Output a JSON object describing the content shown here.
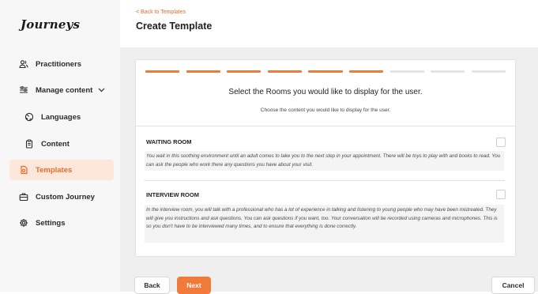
{
  "app": {
    "logo": "Journeys"
  },
  "colors": {
    "accent": "#f07a3a",
    "step_active": "#f07a3a",
    "step_inactive": "#e4e4e4",
    "active_bg": "#fde7da"
  },
  "sidebar": {
    "items": [
      {
        "label": "Practitioners",
        "icon": "users-icon",
        "active": false
      },
      {
        "label": "Manage content",
        "icon": "sliders-icon",
        "active": false,
        "expanded": true
      },
      {
        "label": "Languages",
        "icon": "globe-icon",
        "active": false,
        "sub": true
      },
      {
        "label": "Content",
        "icon": "clipboard-icon",
        "active": false,
        "sub": true
      },
      {
        "label": "Templates",
        "icon": "template-icon",
        "active": true
      },
      {
        "label": "Custom Journey",
        "icon": "briefcase-icon",
        "active": false
      },
      {
        "label": "Settings",
        "icon": "gear-icon",
        "active": false
      }
    ]
  },
  "header": {
    "back_link": "< Back to Templates",
    "title": "Create Template"
  },
  "wizard": {
    "steps_total": 9,
    "steps_completed": 6,
    "title": "Select the Rooms you would like to display for the user.",
    "subtitle": "Choose the content you would like to display for the user.",
    "rooms": [
      {
        "name": "WAITING ROOM",
        "description": "You wait in this soothing environment until an adult comes to take you to the next step in your appointment. There will be toys to play with and books to read. You can ask the people who work there any questions you have about your visit.",
        "checked": false
      },
      {
        "name": "INTERVIEW ROOM",
        "description": "In the interview room, you will talk with a professional who has a lot of experience in talking and listening to young people who may have been mistreated. They will give you instructions and ask questions. You can ask questions if you want, too. Your conversation will be recorded using cameras and microphones. This is so you don't have to be interviewed many times, and to ensure that everything is done correctly.",
        "checked": false
      }
    ]
  },
  "footer": {
    "back_label": "Back",
    "next_label": "Next",
    "cancel_label": "Cancel"
  }
}
